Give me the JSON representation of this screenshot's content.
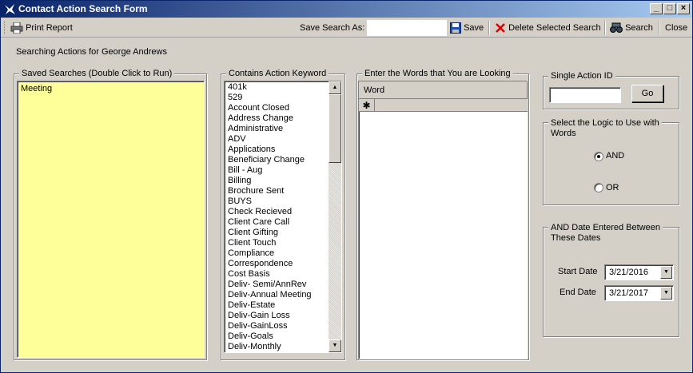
{
  "window": {
    "title": "Contact Action Search Form",
    "controls": {
      "minimize": "_",
      "maximize": "□",
      "close": "×"
    }
  },
  "toolbar": {
    "print_label": "Print Report",
    "save_search_as_label": "Save Search As:",
    "save_search_value": "",
    "save_label": "Save",
    "delete_label": "Delete Selected Search",
    "search_label": "Search",
    "close_label": "Close"
  },
  "context": {
    "searching_for": "Searching Actions for George Andrews"
  },
  "saved_searches": {
    "title": "Saved Searches (Double Click to Run)",
    "items": [
      "Meeting"
    ]
  },
  "keywords": {
    "title": "Contains Action Keyword",
    "items": [
      "401k",
      "529",
      "Account Closed",
      "Address Change",
      "Administrative",
      "ADV",
      "Applications",
      "Beneficiary Change",
      "Bill - Aug",
      "Billing",
      "Brochure Sent",
      "BUYS",
      "Check Recieved",
      "Client Care Call",
      "Client Gifting",
      "Client Touch",
      "Compliance",
      "Correspondence",
      "Cost Basis",
      "Deliv- Semi/AnnRev",
      "Deliv-Annual Meeting",
      "Deliv-Estate",
      "Deliv-Gain  Loss",
      "Deliv-GainLoss",
      "Deliv-Goals",
      "Deliv-Monthly"
    ]
  },
  "words": {
    "title": "Enter the Words that You are Looking",
    "column_header": "Word",
    "new_row_marker": "✱"
  },
  "single_action": {
    "title": "Single Action ID",
    "value": "",
    "go_label": "Go"
  },
  "logic": {
    "title": "Select the Logic to Use with Words",
    "title_line1": "Select the Logic to Use with",
    "title_line2": "Words",
    "options": [
      {
        "label": "AND",
        "checked": true
      },
      {
        "label": "OR",
        "checked": false
      }
    ]
  },
  "dates": {
    "title_line1": "AND Date Entered Between",
    "title_line2": "These Dates",
    "start_label": "Start Date",
    "start_value": "3/21/2016",
    "end_label": "End Date",
    "end_value": "3/21/2017"
  },
  "colors": {
    "title_start": "#0a246a",
    "title_end": "#a6caf0",
    "saved_bg": "#ffff99",
    "face": "#d4d0c8"
  }
}
